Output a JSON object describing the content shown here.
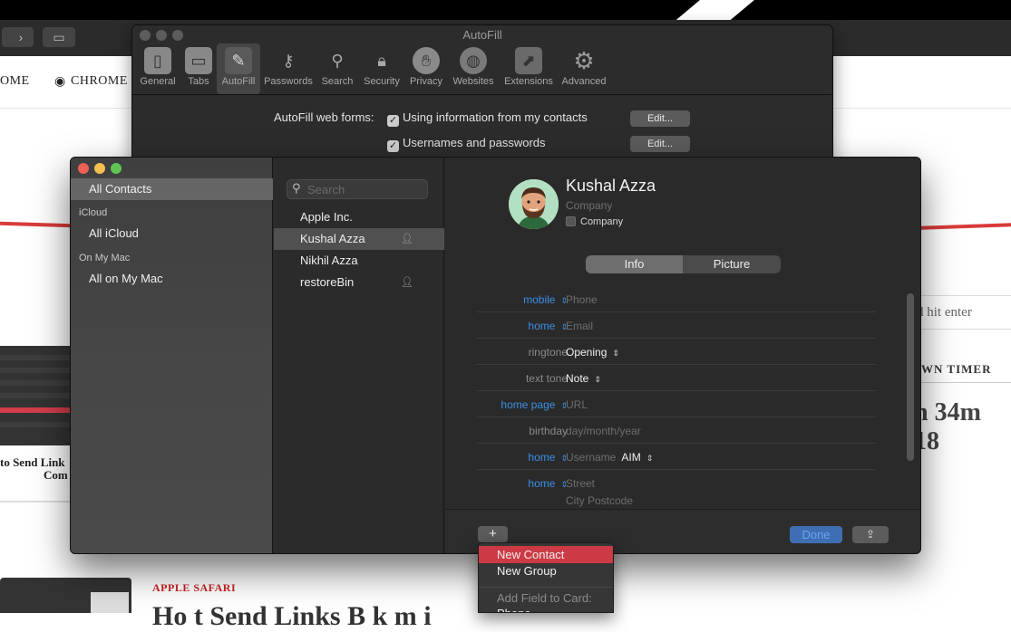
{
  "background_page": {
    "nav_items": [
      "OME",
      "CHROME"
    ],
    "search_placeholder": "d hit enter",
    "timer_label": "WN TIMER",
    "timer_value": "n 34m 18",
    "article_title_lines": [
      "to Send Link",
      "Com"
    ],
    "category": "APPLE SAFARI",
    "heading": "Ho    t  Send Links  B    k m    i"
  },
  "prefs": {
    "title": "AutoFill",
    "tabs": [
      {
        "label": "General",
        "icon": "switch-icon"
      },
      {
        "label": "Tabs",
        "icon": "tabs-icon"
      },
      {
        "label": "AutoFill",
        "icon": "pencil-icon"
      },
      {
        "label": "Passwords",
        "icon": "key-icon"
      },
      {
        "label": "Search",
        "icon": "search-icon"
      },
      {
        "label": "Security",
        "icon": "lock-icon"
      },
      {
        "label": "Privacy",
        "icon": "hand-icon"
      },
      {
        "label": "Websites",
        "icon": "globe-icon"
      },
      {
        "label": "Extensions",
        "icon": "puzzle-icon"
      },
      {
        "label": "Advanced",
        "icon": "gear-icon"
      }
    ],
    "active_tab": "AutoFill",
    "autofill_label": "AutoFill web forms:",
    "options": [
      {
        "label": "Using information from my contacts",
        "checked": true,
        "button": "Edit..."
      },
      {
        "label": "Usernames and passwords",
        "checked": true,
        "button": "Edit..."
      }
    ]
  },
  "contacts": {
    "sidebar": {
      "all_contacts": "All Contacts",
      "icloud_header": "iCloud",
      "all_icloud": "All iCloud",
      "onmymac_header": "On My Mac",
      "all_on_my_mac": "All on My Mac"
    },
    "search": {
      "placeholder": "Search"
    },
    "list": [
      {
        "name": "Apple Inc.",
        "me": false
      },
      {
        "name": "Kushal Azza",
        "me": true
      },
      {
        "name": "Nikhil Azza",
        "me": false
      },
      {
        "name": "restoreBin",
        "me": true
      }
    ],
    "selected": "Kushal Azza",
    "card": {
      "name": "Kushal  Azza",
      "company_placeholder": "Company",
      "company_checkbox": "Company",
      "tabs": [
        "Info",
        "Picture"
      ],
      "fields": [
        {
          "label": "mobile",
          "value": "Phone",
          "label_style": "blue",
          "value_style": "ph",
          "value_stepper": false
        },
        {
          "label": "home",
          "value": "Email",
          "label_style": "blue",
          "value_style": "ph",
          "value_stepper": false
        },
        {
          "label": "ringtone",
          "value": "Opening",
          "label_style": "grey",
          "value_style": "on",
          "value_stepper": true
        },
        {
          "label": "text tone",
          "value": "Note",
          "label_style": "grey",
          "value_style": "on",
          "value_stepper": true
        },
        {
          "label": "home page",
          "value": "URL",
          "label_style": "blue",
          "value_style": "ph",
          "value_stepper": false
        },
        {
          "label": "birthday",
          "value": "day/month/year",
          "label_style": "grey",
          "value_style": "ph",
          "value_stepper": false
        },
        {
          "label": "home",
          "value": "Username",
          "label_style": "blue",
          "value_style": "ph",
          "value_stepper": false,
          "extra": "AIM"
        },
        {
          "label": "home",
          "value": "Street",
          "label_style": "blue",
          "value_style": "ph",
          "value_stepper": false,
          "line2": "City Postcode"
        }
      ]
    },
    "footer": {
      "add": "+",
      "done": "Done",
      "share_icon": "share-icon"
    }
  },
  "menu": {
    "items": [
      "New Contact",
      "New Group"
    ],
    "disabled_header": "Add Field to Card:",
    "partial_item": "Phone"
  },
  "colors": {
    "accent_blue": "#3b8fe8",
    "menu_highlight": "#cc3a45",
    "traffic_red": "#ec5f56",
    "traffic_yellow": "#f5bf4f",
    "traffic_green": "#5fc453"
  }
}
